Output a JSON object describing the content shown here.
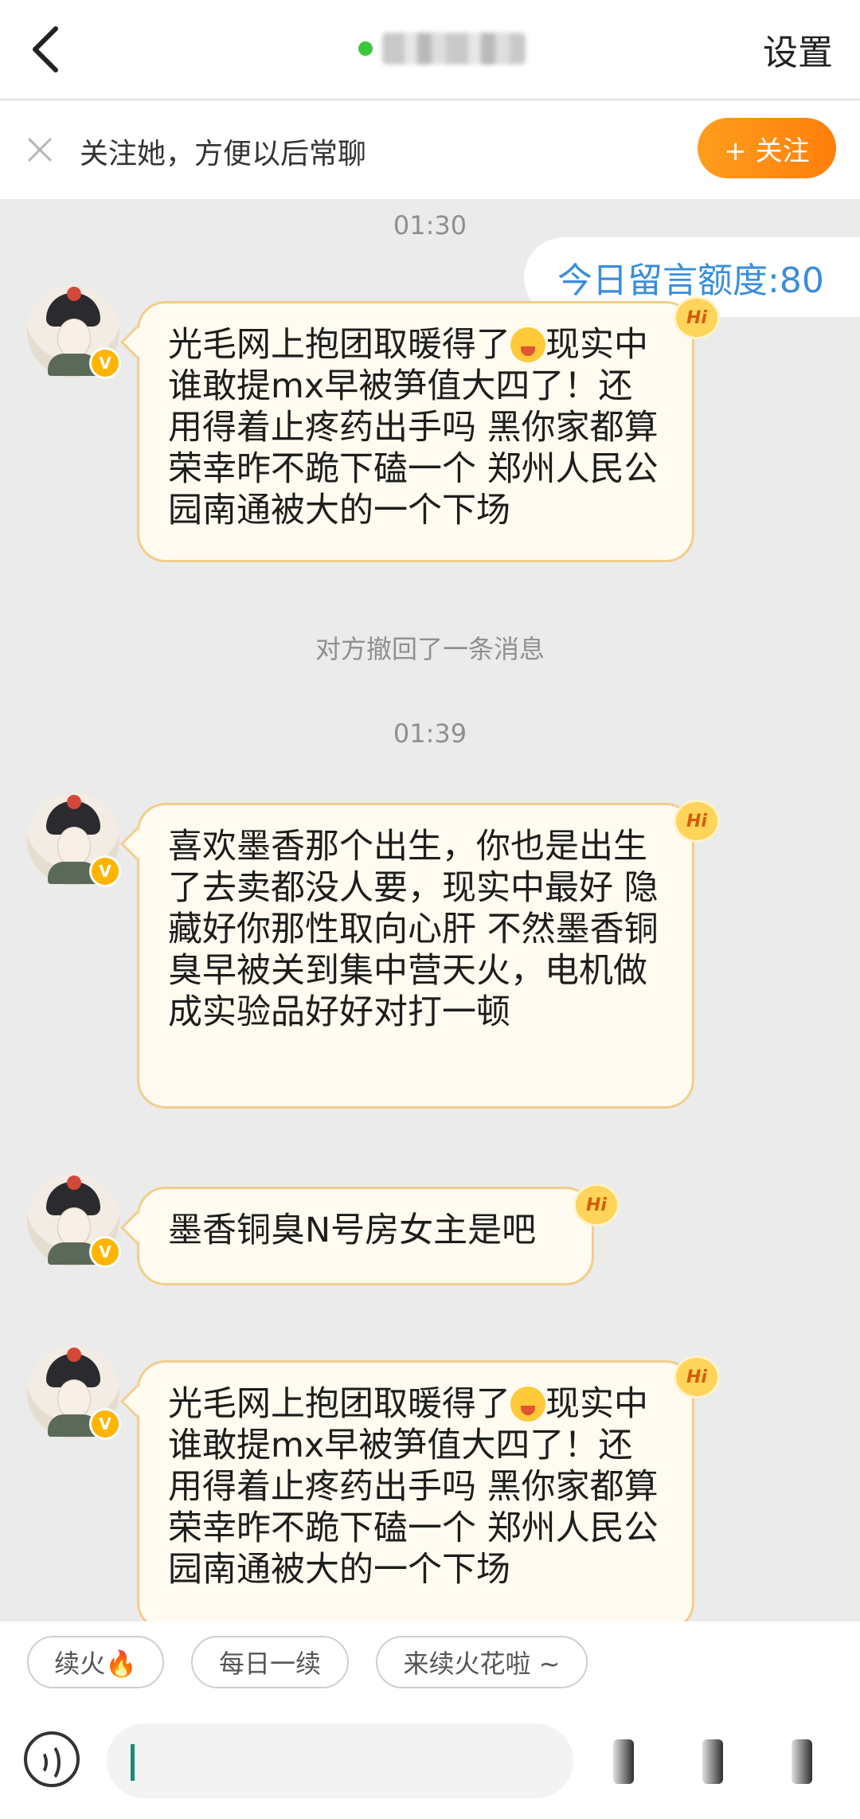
{
  "header": {
    "back_icon": "chevron-left-icon",
    "settings_label": "设置"
  },
  "follow_bar": {
    "text": "关注她，方便以后常聊",
    "button_label": "+ 关注"
  },
  "chat": {
    "quota_label": "今日留言额度:80",
    "items": [
      {
        "type": "time",
        "text": "01:30"
      },
      {
        "type": "message",
        "parts": [
          "光毛网上抱团取暖得了",
          "现实中谁敢提mx早被笋值大四了！还用得着止疼药出手吗 黑你家都算荣幸昨不跪下磕一个 郑州人民公园南通被大的一个下场"
        ]
      },
      {
        "type": "notice",
        "text": "对方撤回了一条消息"
      },
      {
        "type": "time",
        "text": "01:39"
      },
      {
        "type": "message",
        "text": "喜欢墨香那个出生，你也是出生了去卖都没人要，现实中最好 隐藏好你那性取向心肝 不然墨香铜臭早被关到集中营天火，电机做成实验品好好对打一顿"
      },
      {
        "type": "message",
        "text": "墨香铜臭N号房女主是吧"
      },
      {
        "type": "message",
        "parts": [
          "光毛网上抱团取暖得了",
          "现实中谁敢提mx早被笋值大四了！还用得着止疼药出手吗 黑你家都算荣幸昨不跪下磕一个 郑州人民公园南通被大的一个下场"
        ]
      }
    ],
    "badge_label": "V",
    "hi_label": "Hi"
  },
  "quick_replies": [
    "续火🔥",
    "每日一续",
    "来续火花啦 ~"
  ],
  "input_bar": {
    "voice_icon": "voice-icon",
    "tool_icons": [
      "tool-icon-1",
      "tool-icon-2",
      "tool-icon-3"
    ]
  },
  "colors": {
    "accent_orange": "#ff8c12",
    "bubble_bg": "#fffbf0",
    "bubble_border": "#f3cd8c",
    "quota_blue": "#3a8ed8"
  }
}
